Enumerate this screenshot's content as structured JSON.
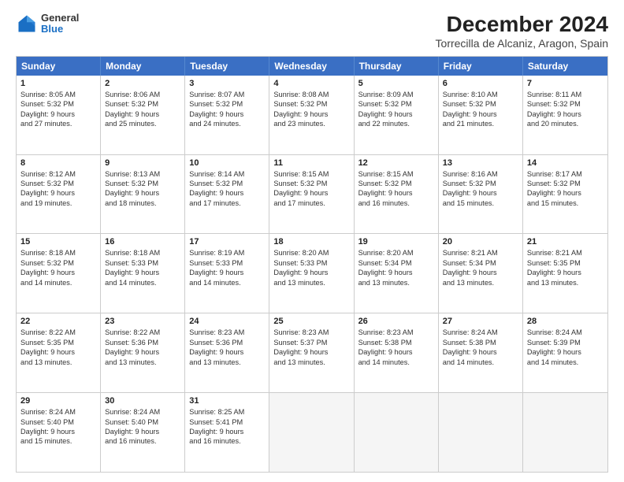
{
  "logo": {
    "line1": "General",
    "line2": "Blue"
  },
  "title": "December 2024",
  "subtitle": "Torrecilla de Alcaniz, Aragon, Spain",
  "header_days": [
    "Sunday",
    "Monday",
    "Tuesday",
    "Wednesday",
    "Thursday",
    "Friday",
    "Saturday"
  ],
  "weeks": [
    [
      {
        "day": "1",
        "lines": [
          "Sunrise: 8:05 AM",
          "Sunset: 5:32 PM",
          "Daylight: 9 hours",
          "and 27 minutes."
        ]
      },
      {
        "day": "2",
        "lines": [
          "Sunrise: 8:06 AM",
          "Sunset: 5:32 PM",
          "Daylight: 9 hours",
          "and 25 minutes."
        ]
      },
      {
        "day": "3",
        "lines": [
          "Sunrise: 8:07 AM",
          "Sunset: 5:32 PM",
          "Daylight: 9 hours",
          "and 24 minutes."
        ]
      },
      {
        "day": "4",
        "lines": [
          "Sunrise: 8:08 AM",
          "Sunset: 5:32 PM",
          "Daylight: 9 hours",
          "and 23 minutes."
        ]
      },
      {
        "day": "5",
        "lines": [
          "Sunrise: 8:09 AM",
          "Sunset: 5:32 PM",
          "Daylight: 9 hours",
          "and 22 minutes."
        ]
      },
      {
        "day": "6",
        "lines": [
          "Sunrise: 8:10 AM",
          "Sunset: 5:32 PM",
          "Daylight: 9 hours",
          "and 21 minutes."
        ]
      },
      {
        "day": "7",
        "lines": [
          "Sunrise: 8:11 AM",
          "Sunset: 5:32 PM",
          "Daylight: 9 hours",
          "and 20 minutes."
        ]
      }
    ],
    [
      {
        "day": "8",
        "lines": [
          "Sunrise: 8:12 AM",
          "Sunset: 5:32 PM",
          "Daylight: 9 hours",
          "and 19 minutes."
        ]
      },
      {
        "day": "9",
        "lines": [
          "Sunrise: 8:13 AM",
          "Sunset: 5:32 PM",
          "Daylight: 9 hours",
          "and 18 minutes."
        ]
      },
      {
        "day": "10",
        "lines": [
          "Sunrise: 8:14 AM",
          "Sunset: 5:32 PM",
          "Daylight: 9 hours",
          "and 17 minutes."
        ]
      },
      {
        "day": "11",
        "lines": [
          "Sunrise: 8:15 AM",
          "Sunset: 5:32 PM",
          "Daylight: 9 hours",
          "and 17 minutes."
        ]
      },
      {
        "day": "12",
        "lines": [
          "Sunrise: 8:15 AM",
          "Sunset: 5:32 PM",
          "Daylight: 9 hours",
          "and 16 minutes."
        ]
      },
      {
        "day": "13",
        "lines": [
          "Sunrise: 8:16 AM",
          "Sunset: 5:32 PM",
          "Daylight: 9 hours",
          "and 15 minutes."
        ]
      },
      {
        "day": "14",
        "lines": [
          "Sunrise: 8:17 AM",
          "Sunset: 5:32 PM",
          "Daylight: 9 hours",
          "and 15 minutes."
        ]
      }
    ],
    [
      {
        "day": "15",
        "lines": [
          "Sunrise: 8:18 AM",
          "Sunset: 5:32 PM",
          "Daylight: 9 hours",
          "and 14 minutes."
        ]
      },
      {
        "day": "16",
        "lines": [
          "Sunrise: 8:18 AM",
          "Sunset: 5:33 PM",
          "Daylight: 9 hours",
          "and 14 minutes."
        ]
      },
      {
        "day": "17",
        "lines": [
          "Sunrise: 8:19 AM",
          "Sunset: 5:33 PM",
          "Daylight: 9 hours",
          "and 14 minutes."
        ]
      },
      {
        "day": "18",
        "lines": [
          "Sunrise: 8:20 AM",
          "Sunset: 5:33 PM",
          "Daylight: 9 hours",
          "and 13 minutes."
        ]
      },
      {
        "day": "19",
        "lines": [
          "Sunrise: 8:20 AM",
          "Sunset: 5:34 PM",
          "Daylight: 9 hours",
          "and 13 minutes."
        ]
      },
      {
        "day": "20",
        "lines": [
          "Sunrise: 8:21 AM",
          "Sunset: 5:34 PM",
          "Daylight: 9 hours",
          "and 13 minutes."
        ]
      },
      {
        "day": "21",
        "lines": [
          "Sunrise: 8:21 AM",
          "Sunset: 5:35 PM",
          "Daylight: 9 hours",
          "and 13 minutes."
        ]
      }
    ],
    [
      {
        "day": "22",
        "lines": [
          "Sunrise: 8:22 AM",
          "Sunset: 5:35 PM",
          "Daylight: 9 hours",
          "and 13 minutes."
        ]
      },
      {
        "day": "23",
        "lines": [
          "Sunrise: 8:22 AM",
          "Sunset: 5:36 PM",
          "Daylight: 9 hours",
          "and 13 minutes."
        ]
      },
      {
        "day": "24",
        "lines": [
          "Sunrise: 8:23 AM",
          "Sunset: 5:36 PM",
          "Daylight: 9 hours",
          "and 13 minutes."
        ]
      },
      {
        "day": "25",
        "lines": [
          "Sunrise: 8:23 AM",
          "Sunset: 5:37 PM",
          "Daylight: 9 hours",
          "and 13 minutes."
        ]
      },
      {
        "day": "26",
        "lines": [
          "Sunrise: 8:23 AM",
          "Sunset: 5:38 PM",
          "Daylight: 9 hours",
          "and 14 minutes."
        ]
      },
      {
        "day": "27",
        "lines": [
          "Sunrise: 8:24 AM",
          "Sunset: 5:38 PM",
          "Daylight: 9 hours",
          "and 14 minutes."
        ]
      },
      {
        "day": "28",
        "lines": [
          "Sunrise: 8:24 AM",
          "Sunset: 5:39 PM",
          "Daylight: 9 hours",
          "and 14 minutes."
        ]
      }
    ],
    [
      {
        "day": "29",
        "lines": [
          "Sunrise: 8:24 AM",
          "Sunset: 5:40 PM",
          "Daylight: 9 hours",
          "and 15 minutes."
        ]
      },
      {
        "day": "30",
        "lines": [
          "Sunrise: 8:24 AM",
          "Sunset: 5:40 PM",
          "Daylight: 9 hours",
          "and 16 minutes."
        ]
      },
      {
        "day": "31",
        "lines": [
          "Sunrise: 8:25 AM",
          "Sunset: 5:41 PM",
          "Daylight: 9 hours",
          "and 16 minutes."
        ]
      },
      null,
      null,
      null,
      null
    ]
  ]
}
